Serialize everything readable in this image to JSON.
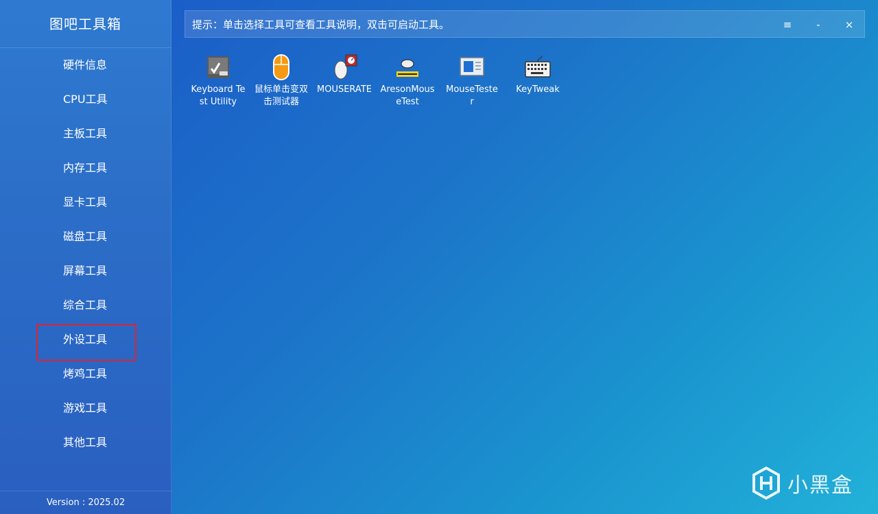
{
  "app": {
    "title": "图吧工具箱",
    "version": "Version : 2025.02"
  },
  "sidebar": {
    "items": [
      {
        "label": "硬件信息"
      },
      {
        "label": "CPU工具"
      },
      {
        "label": "主板工具"
      },
      {
        "label": "内存工具"
      },
      {
        "label": "显卡工具"
      },
      {
        "label": "磁盘工具"
      },
      {
        "label": "屏幕工具"
      },
      {
        "label": "综合工具"
      },
      {
        "label": "外设工具",
        "selected": true
      },
      {
        "label": "烤鸡工具"
      },
      {
        "label": "游戏工具"
      },
      {
        "label": "其他工具"
      }
    ]
  },
  "topbar": {
    "hint": "提示：单击选择工具可查看工具说明，双击可启动工具。",
    "menu_glyph": "≡",
    "min_glyph": "-",
    "close_glyph": "×"
  },
  "tools": [
    {
      "label": "Keyboard Test Utility",
      "icon": "keyboard-test-icon"
    },
    {
      "label": "鼠标单击变双击测试器",
      "icon": "mouse-click-test-icon"
    },
    {
      "label": "MOUSERATE",
      "icon": "mouserate-icon"
    },
    {
      "label": "AresonMouseTest",
      "icon": "areson-mouse-icon"
    },
    {
      "label": "MouseTester",
      "icon": "mousetester-icon"
    },
    {
      "label": "KeyTweak",
      "icon": "keytweak-icon"
    }
  ],
  "watermark": {
    "text": "小黑盒"
  },
  "colors": {
    "selected_outline": "#e0232f",
    "sidebar": "#2b6ec8",
    "background": "#1c74c9"
  }
}
